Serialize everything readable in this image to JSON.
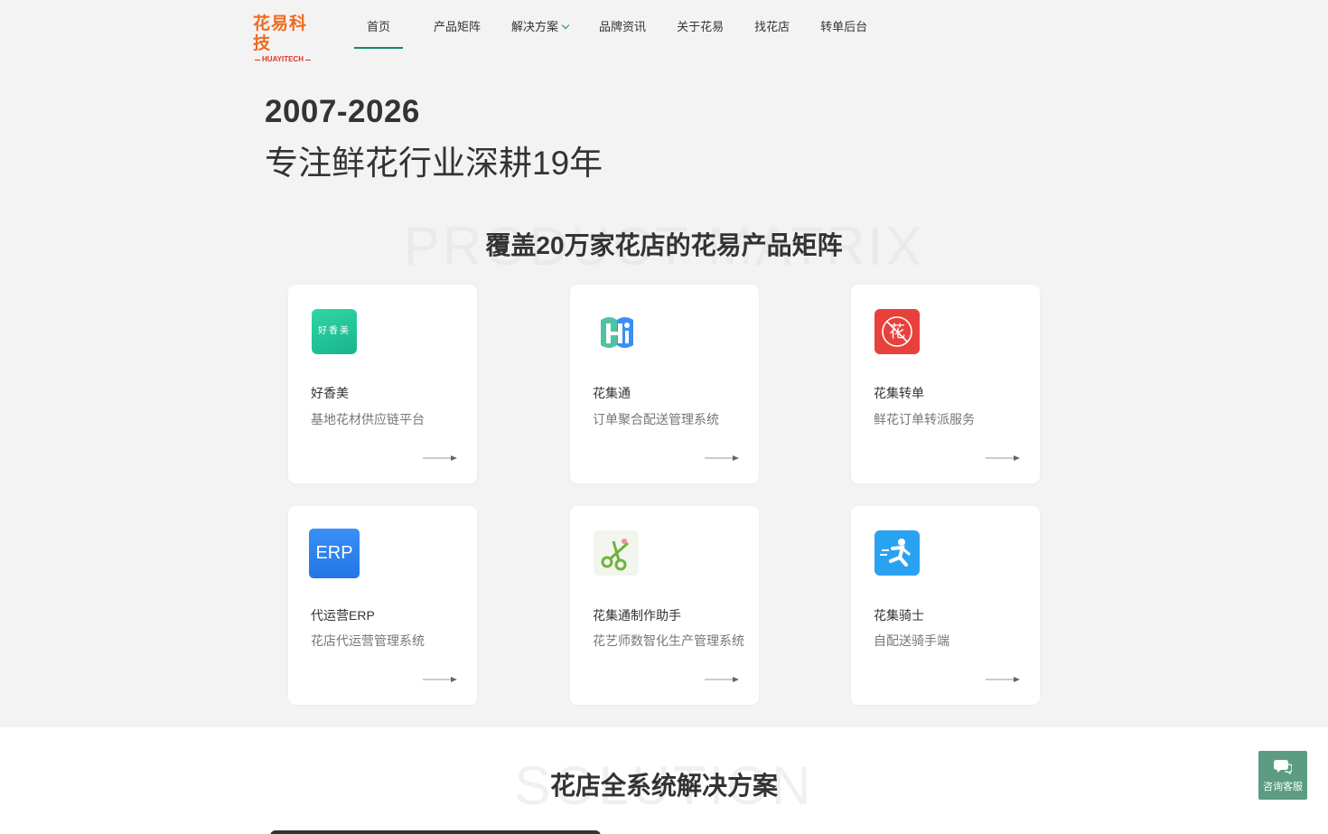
{
  "brand": {
    "name": "花易科技",
    "sub": "HUAYITECH"
  },
  "nav": [
    {
      "label": "首页",
      "active": true
    },
    {
      "label": "产品矩阵"
    },
    {
      "label": "解决方案",
      "dropdown": true
    },
    {
      "label": "品牌资讯"
    },
    {
      "label": "关于花易"
    },
    {
      "label": "找花店"
    },
    {
      "label": "转单后台"
    }
  ],
  "hero": {
    "years": "2007-2026",
    "slogan": "专注鲜花行业深耕19年"
  },
  "products_section": {
    "title": "覆盖20万家花店的花易产品矩阵",
    "bg_text": "PRODUCT MATRIX"
  },
  "products": [
    {
      "name": "好香美",
      "desc": "基地花材供应链平台",
      "icon": "haoxiangmei-logo",
      "icon_text": "好香美"
    },
    {
      "name": "花集通",
      "desc": "订单聚合配送管理系统",
      "icon": "huajitong-logo"
    },
    {
      "name": "花集转单",
      "desc": "鲜花订单转派服务",
      "icon": "huaji-zhuandan-logo"
    },
    {
      "name": "代运营ERP",
      "desc": "花店代运营管理系统",
      "icon": "erp-logo",
      "icon_text": "ERP"
    },
    {
      "name": "花集通制作助手",
      "desc": "花艺师数智化生产管理系统",
      "icon": "scissors-logo"
    },
    {
      "name": "花集骑士",
      "desc": "自配送骑手端",
      "icon": "rider-logo"
    }
  ],
  "solution_section": {
    "title": "花店全系统解决方案",
    "bg_text": "SOLUTION"
  },
  "consult": {
    "label": "咨询客服",
    "color": "#5c9c83"
  },
  "colors": {
    "accent": "#148a72",
    "brand_orange": "#f06a1e"
  }
}
